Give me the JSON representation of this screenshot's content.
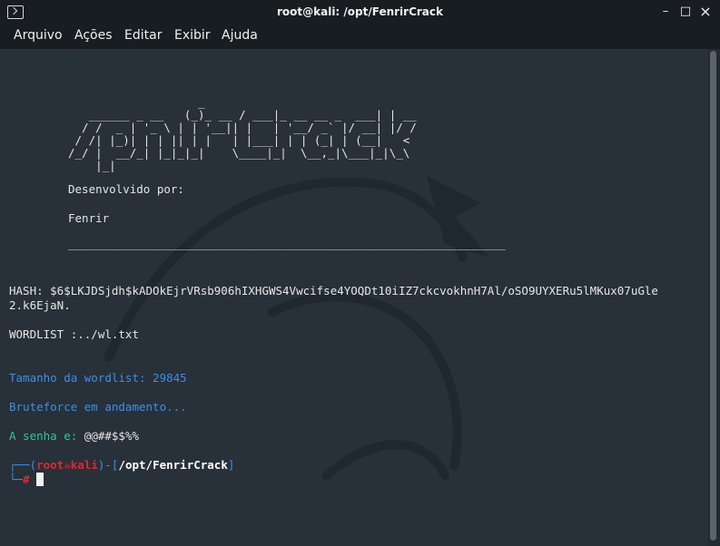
{
  "window": {
    "title": "root@kali: /opt/FenrirCrack"
  },
  "controls": {
    "minimize": "–",
    "maximize": "□",
    "close": "×"
  },
  "menu": [
    "Arquivo",
    "Ações",
    "Editar",
    "Exibir",
    "Ajuda"
  ],
  "terminal": {
    "ascii_art": "                   _  \n   ______ _ __   (_)_ __ / ___|_ __ __ _  ___| | __\n  / /  _ | '_ \\ | | '__|| |   | '__/ _` |/ __| |/ /\n / /| |_)| | | || | |   | |___| | | (_| | (__|   <\n/_/ |  __/_| |_|_|_|    \\____|_|  \\__,_|\\___|_|\\_\\\n    |_|",
    "developed_by": "Desenvolvido por:",
    "author": "Fenrir",
    "separator": "________________________________________________________________",
    "hash_line1": "HASH: $6$LKJDSjdh$kADOkEjrVRsb906hIXHGWS4Vwcifse4YOQDt10iIZ7ckcvokhnH7Al/oSO9UYXERu5lMKux07uGle",
    "hash_line2": "2.k6EjaN.",
    "wordlist": "WORDLIST :../wl.txt",
    "wordlist_size": "Tamanho da wordlist: 29845",
    "bruteforce": "Bruteforce em andamento...",
    "password_label": "A senha e: ",
    "password_value": "@@##$$%%",
    "prompt_user": "root",
    "prompt_host": "kali",
    "prompt_path": "/opt/FenrirCrack",
    "prompt_symbol": "#"
  },
  "colors": {
    "background": "#283039",
    "blue": "#3e8ee8",
    "green": "#36c29b",
    "prompt_red": "#e0282e"
  },
  "icons": {
    "terminal": "terminal-icon",
    "skull": "skull-icon"
  }
}
